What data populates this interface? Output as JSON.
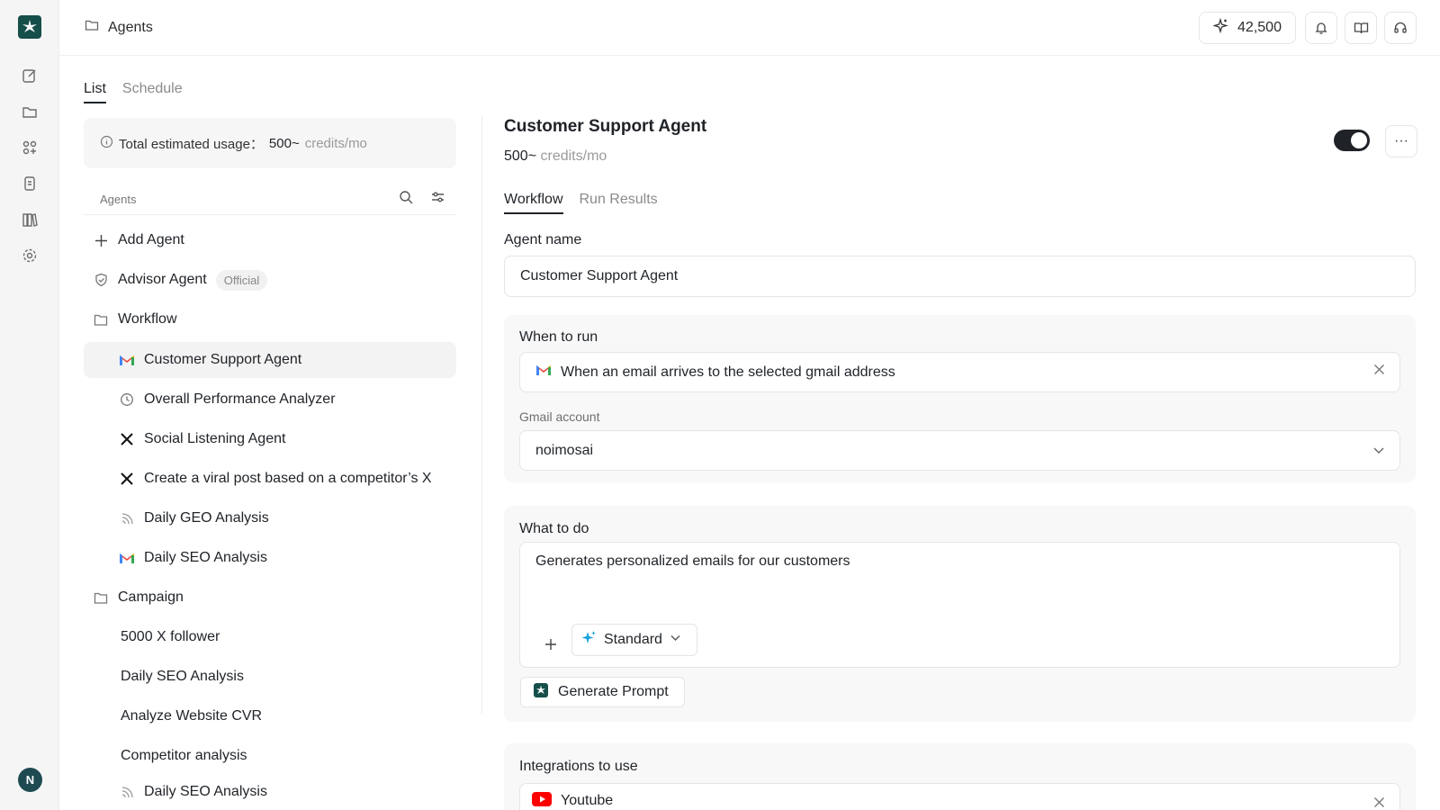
{
  "app": {
    "credits_balance": "42,500",
    "avatar_initial": "N"
  },
  "breadcrumb": {
    "label": "Agents"
  },
  "left_tabs": [
    {
      "label": "List",
      "active": true
    },
    {
      "label": "Schedule",
      "active": false
    }
  ],
  "usage": {
    "label": "Total estimated usage：",
    "value": "500~",
    "unit": "credits/mo"
  },
  "agents_header": {
    "label": "Agents"
  },
  "tree": [
    {
      "label": "Add Agent",
      "icon": "plus-icon"
    },
    {
      "label": "Advisor Agent",
      "icon": "shield-icon",
      "badge": "Official"
    },
    {
      "label": "Workflow",
      "icon": "folder-icon"
    },
    {
      "label": "Customer Support Agent",
      "icon": "gmail-icon",
      "active": true
    },
    {
      "label": "Overall Performance Analyzer",
      "icon": "clock-icon"
    },
    {
      "label": "Social Listening Agent",
      "icon": "x-logo-icon"
    },
    {
      "label": "Create a viral post based on a competitor’s X",
      "icon": "x-logo-icon"
    },
    {
      "label": "Daily GEO Analysis",
      "icon": "rss-icon"
    },
    {
      "label": "Daily SEO Analysis",
      "icon": "gmail-icon"
    },
    {
      "label": "Campaign",
      "icon": "folder-icon"
    },
    {
      "label": "5000 X follower"
    },
    {
      "label": "Daily SEO Analysis"
    },
    {
      "label": "Analyze Website CVR"
    },
    {
      "label": "Competitor analysis"
    },
    {
      "label": "Daily SEO Analysis",
      "icon": "rss-icon"
    }
  ],
  "detail": {
    "title": "Customer Support Agent",
    "cost_value": "500~",
    "cost_unit": "credits/mo",
    "enabled": true,
    "tabs": [
      {
        "label": "Workflow",
        "active": true
      },
      {
        "label": "Run Results",
        "active": false
      }
    ],
    "agent_name_label": "Agent name",
    "agent_name_value": "Customer Support Agent",
    "when_to_run_label": "When to run",
    "trigger_text": "When an email arrives to the selected gmail address",
    "gmail_account_label": "Gmail account",
    "gmail_account_value": "noimosai",
    "what_to_do_label": "What to do",
    "prompt_text": "Generates personalized emails for our customers",
    "model_label": "Standard",
    "generate_prompt_label": "Generate Prompt",
    "integrations_label": "Integrations to use",
    "integration_item": "Youtube"
  },
  "colors": {
    "accent_dark": "#1f2328",
    "logo_teal": "#164e4a",
    "gmail_red": "#ea4335",
    "youtube_red": "#ff0000"
  }
}
